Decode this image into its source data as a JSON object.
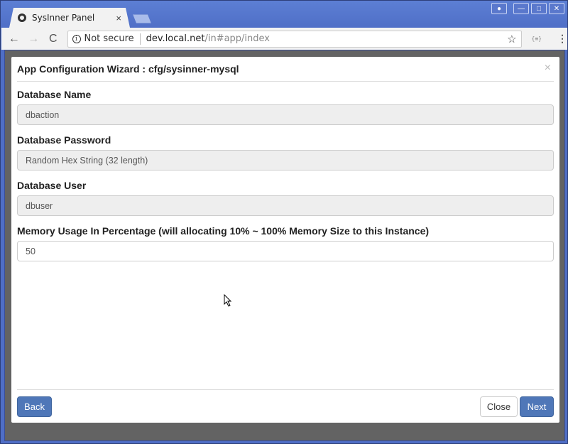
{
  "browser": {
    "tab_title": "SysInner Panel",
    "tab_close": "×",
    "security_label": "Not secure",
    "url_host": "dev.local.net",
    "url_path": "/in#app/index",
    "icons": {
      "favicon": "app-favicon",
      "back": "←",
      "forward": "→",
      "reload": "C",
      "info": "i",
      "star": "☆",
      "extension": "{≡}",
      "menu": "⋮",
      "profile": "●",
      "minimize": "—",
      "maximize": "□",
      "close": "✕"
    }
  },
  "modal": {
    "title": "App Configuration Wizard : cfg/sysinner-mysql",
    "close_icon": "×",
    "fields": [
      {
        "label": "Database Name",
        "value": "dbaction",
        "readonly": true
      },
      {
        "label": "Database Password",
        "value": "Random Hex String (32 length)",
        "readonly": true
      },
      {
        "label": "Database User",
        "value": "dbuser",
        "readonly": true
      },
      {
        "label": "Memory Usage In Percentage (will allocating 10% ~ 100% Memory Size to this Instance)",
        "value": "50",
        "readonly": false
      }
    ],
    "buttons": {
      "back": "Back",
      "close": "Close",
      "next": "Next"
    },
    "colors": {
      "primary": "#4f77b8",
      "overlay": "#636363"
    }
  }
}
